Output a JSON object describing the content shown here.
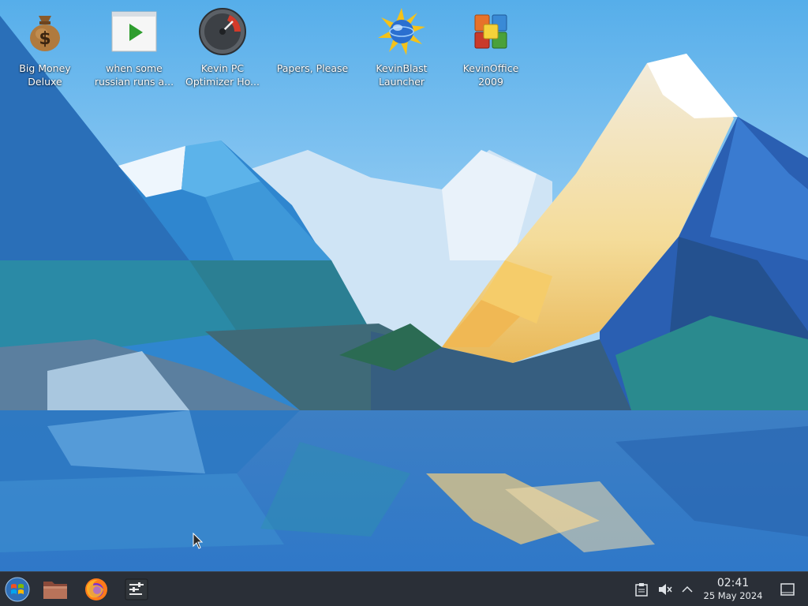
{
  "desktop": {
    "icons": [
      {
        "name": "big-money-deluxe",
        "icon": "money-bag-icon",
        "line1": "Big Money",
        "line2": "Deluxe"
      },
      {
        "name": "when-some-russian",
        "icon": "video-player-icon",
        "line1": "when some",
        "line2": "russian runs a..."
      },
      {
        "name": "kevin-pc-optimizer",
        "icon": "speedometer-icon",
        "line1": "Kevin PC",
        "line2": "Optimizer Ho..."
      },
      {
        "name": "papers-please",
        "icon": "blank-icon",
        "line1": "Papers, Please",
        "line2": ""
      },
      {
        "name": "kevinblast-launcher",
        "icon": "globe-burst-icon",
        "line1": "KevinBlast",
        "line2": "Launcher"
      },
      {
        "name": "kevinoffice-2009",
        "icon": "office-logo-icon",
        "line1": "KevinOffice",
        "line2": "2009"
      }
    ]
  },
  "taskbar": {
    "launchers": [
      "start-menu-icon",
      "file-manager-icon",
      "firefox-icon",
      "terminal-icon"
    ],
    "tray": [
      "clipboard-icon",
      "volume-muted-icon",
      "chevron-up-icon",
      "show-desktop-icon"
    ],
    "clock": {
      "time": "02:41",
      "date": "25 May 2024"
    }
  },
  "colors": {
    "taskbar": "#2a2f37",
    "sky_top": "#5aaee8",
    "sky_bottom": "#b9defa"
  }
}
